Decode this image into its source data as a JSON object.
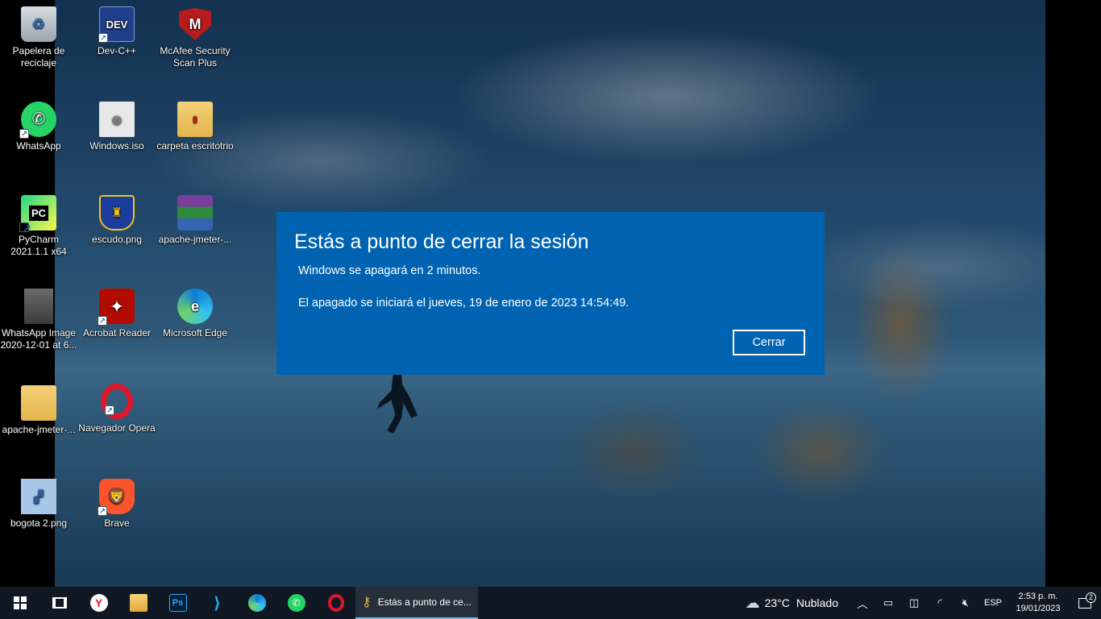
{
  "desktop": {
    "icons": [
      {
        "label": "Papelera de reciclaje",
        "icon": "recycle-bin-icon"
      },
      {
        "label": "Dev-C++",
        "icon": "devcpp-icon",
        "glyph": "DEV"
      },
      {
        "label": "McAfee Security Scan Plus",
        "icon": "mcafee-icon",
        "glyph": "M"
      },
      {
        "label": "WhatsApp",
        "icon": "whatsapp-icon"
      },
      {
        "label": "Windows.iso",
        "icon": "disc-image-icon"
      },
      {
        "label": "carpeta escritotrio",
        "icon": "folder-icon"
      },
      {
        "label": "PyCharm 2021.1.1 x64",
        "icon": "pycharm-icon",
        "glyph": "PC"
      },
      {
        "label": "escudo.png",
        "icon": "image-file-icon"
      },
      {
        "label": "apache-jmeter-...",
        "icon": "winrar-archive-icon"
      },
      {
        "label": "WhatsApp Image 2020-12-01 at 6...",
        "icon": "photo-thumbnail-icon"
      },
      {
        "label": "Acrobat Reader",
        "icon": "acrobat-icon"
      },
      {
        "label": "Microsoft Edge",
        "icon": "edge-icon"
      },
      {
        "label": "apache-jmeter-...",
        "icon": "folder-icon"
      },
      {
        "label": "Navegador Opera",
        "icon": "opera-icon"
      },
      {
        "label": "bogota 2.png",
        "icon": "image-file-icon"
      },
      {
        "label": "Brave",
        "icon": "brave-icon"
      }
    ]
  },
  "dialog": {
    "title": "Estás a punto de cerrar la sesión",
    "line1": "Windows se apagará en 2 minutos.",
    "line2": "El apagado se iniciará el jueves, 19 de enero de 2023 14:54:49.",
    "close_label": "Cerrar",
    "background": "#0063b1"
  },
  "taskbar": {
    "active_task_label": "Estás a punto de ce...",
    "weather": {
      "temp": "23°C",
      "condition": "Nublado"
    },
    "language": "ESP",
    "time": "2:53 p. m.",
    "date": "19/01/2023",
    "notification_count": "2"
  }
}
